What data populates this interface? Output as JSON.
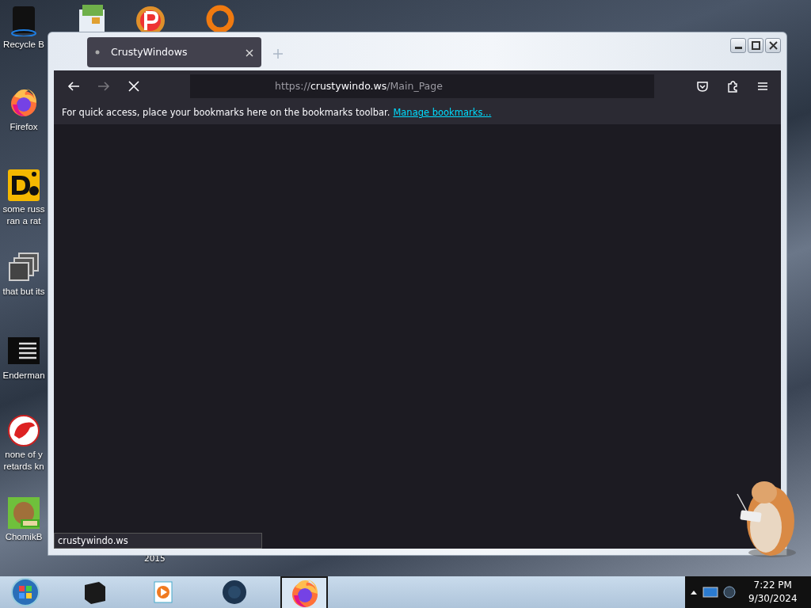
{
  "desktop_icons": [
    {
      "kind": "bin",
      "label": "Recycle B"
    },
    {
      "kind": "firefox",
      "label": "Firefox"
    },
    {
      "kind": "letters",
      "label": "some russ ran a rat"
    },
    {
      "kind": "windows",
      "label": "that but its"
    },
    {
      "kind": "list",
      "label": "Enderman"
    },
    {
      "kind": "dino",
      "label": "none of y retards kn"
    },
    {
      "kind": "box",
      "label": "ChomikB"
    }
  ],
  "desktop_caption": "2015",
  "browser": {
    "tabs": [
      {
        "title": "CrustyWindows",
        "selected": true
      }
    ],
    "url": {
      "scheme": "https://",
      "host": "crustywindo.ws",
      "path": "/Main_Page"
    },
    "bookmarks_hint": "For quick access, place your bookmarks here on the bookmarks toolbar.",
    "bookmarks_link": "Manage bookmarks...",
    "status": "crustywindo.ws"
  },
  "taskbar": {
    "apps": [
      {
        "kind": "terminal",
        "selected": false
      },
      {
        "kind": "media",
        "selected": false
      },
      {
        "kind": "globe",
        "selected": false
      },
      {
        "kind": "firefox",
        "selected": true
      }
    ]
  },
  "clock": {
    "time": "7:22 PM",
    "date": "9/30/2024"
  }
}
